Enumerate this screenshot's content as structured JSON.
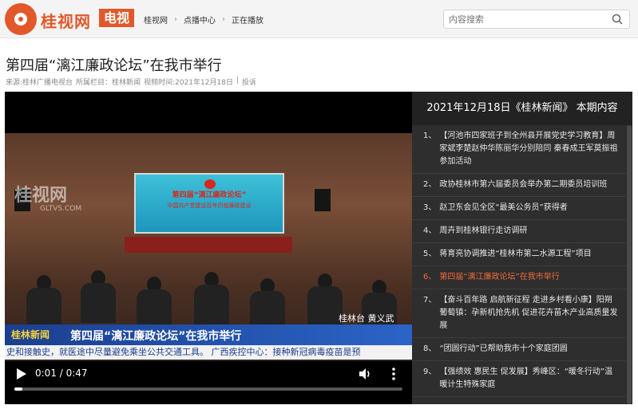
{
  "header": {
    "brand": "桂视网",
    "brand_tag": "电视",
    "breadcrumbs": [
      "桂视网",
      "点播中心",
      "正在播放"
    ],
    "search_placeholder": "内容搜索"
  },
  "article": {
    "title": "第四届“漓江廉政论坛”在我市举行",
    "meta_source": "来源:桂林广播电视台",
    "meta_column": "所属栏目：桂林新闻",
    "meta_time": "视频时间:2021年12月18日",
    "meta_sep": "|",
    "meta_submit": "投诉"
  },
  "video": {
    "screen_line1": "第四届“漓江廉政论坛”",
    "screen_line2": "中国共产党建设百年历程廉政建设",
    "watermark": "桂视网",
    "watermark_sub": "GLTVS.COM",
    "lower_logo": "桂林新闻",
    "lower_title": "第四届“漓江廉政论坛”在我市举行",
    "reporter": "桂林台  黄义武",
    "ticker": "史和接触史，就医途中尽量避免乘坐公共交通工具。  广西疾控中心：接种新冠病毒疫苗是预",
    "time": "0:01 / 0:47",
    "progress": 0.02
  },
  "playlist": {
    "title": "2021年12月18日《桂林新闻》 本期内容",
    "items": [
      {
        "num": "1、",
        "text": "【河池市四家班子到全州县开展党史学习教育】周家斌李楚赵仲华陈丽华分别陪同 秦春成王军莫振祖参加活动",
        "active": false
      },
      {
        "num": "2、",
        "text": "政协桂林市第六届委员会举办第二期委员培训班",
        "active": false
      },
      {
        "num": "3、",
        "text": "赵卫东会见全区“最美公务员”获得者",
        "active": false
      },
      {
        "num": "4、",
        "text": "周卉到桂林银行走访调研",
        "active": false
      },
      {
        "num": "5、",
        "text": "蒋育亮协调推进“桂林市第二水源工程”项目",
        "active": false
      },
      {
        "num": "6、",
        "text": "第四届“漓江廉政论坛”在我市举行",
        "active": true
      },
      {
        "num": "7、",
        "text": "【奋斗百年路 启航新征程 走进乡村看小康】阳朔葡萄镇：孕新机抢先机 促进花卉苗木产业高质量发展",
        "active": false
      },
      {
        "num": "8、",
        "text": "“团圆行动”已帮助我市十个家庭团圆",
        "active": false
      },
      {
        "num": "9、",
        "text": "【强绩效 惠民生 促发展】秀峰区：“暖冬行动”温暖计生特殊家庭",
        "active": false
      }
    ]
  },
  "colors": {
    "brand": "#e2582a",
    "active_item": "#f06a3c",
    "panel_bg": "#2e2e2e"
  }
}
